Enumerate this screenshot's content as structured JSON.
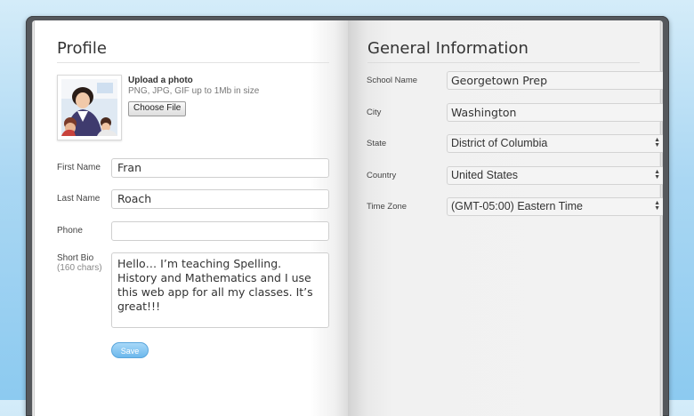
{
  "profile": {
    "title": "Profile",
    "upload": {
      "title": "Upload a photo",
      "hint": "PNG, JPG, GIF up to 1Mb in size",
      "button": "Choose File"
    },
    "first_name": {
      "label": "First Name",
      "value": "Fran"
    },
    "last_name": {
      "label": "Last Name",
      "value": "Roach"
    },
    "phone": {
      "label": "Phone",
      "value": ""
    },
    "bio": {
      "label": "Short Bio",
      "sublabel": "(160 chars)",
      "value": "Hello… I’m teaching Spelling. History and Mathematics and I use this web app for all my classes. It’s great!!!"
    },
    "save_label": "Save"
  },
  "general": {
    "title": "General Information",
    "school_name": {
      "label": "School Name",
      "value": "Georgetown Prep"
    },
    "city": {
      "label": "City",
      "value": "Washington"
    },
    "state": {
      "label": "State",
      "value": "District of Columbia"
    },
    "country": {
      "label": "Country",
      "value": "United States"
    },
    "time_zone": {
      "label": "Time Zone",
      "value": "(GMT-05:00) Eastern Time"
    }
  },
  "colors": {
    "accent": "#6db8ec",
    "background": "#aad7f3",
    "book_cover": "#55585c"
  }
}
